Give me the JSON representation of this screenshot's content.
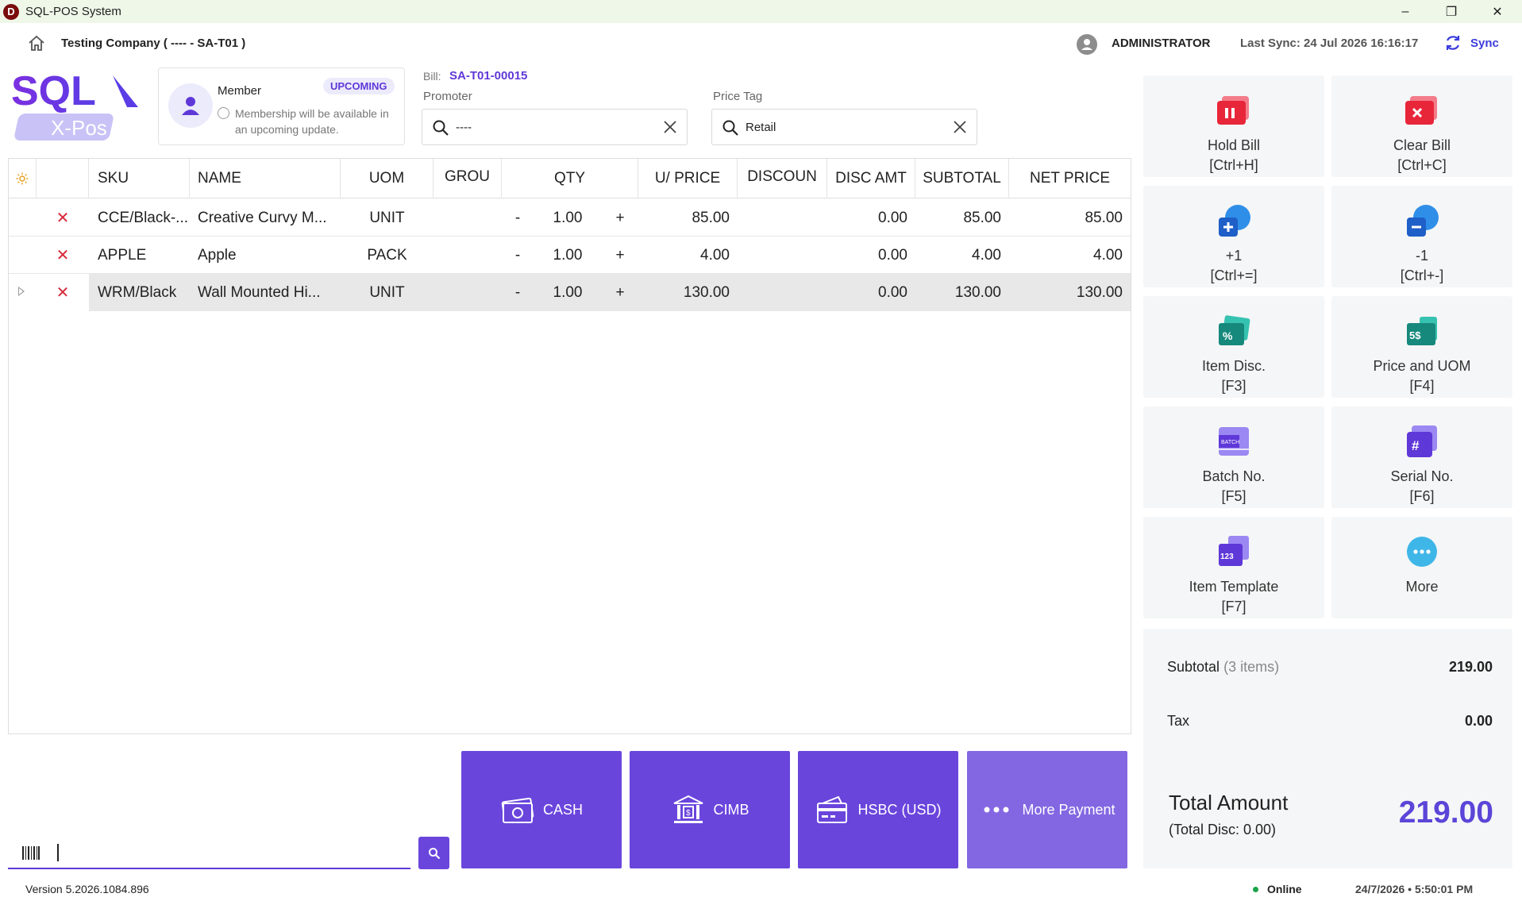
{
  "window": {
    "title": "SQL-POS System",
    "app_icon": "D",
    "minimize": "–",
    "restore": "❐",
    "close": "✕"
  },
  "header": {
    "company": "Testing Company ( ---- - SA-T01 )",
    "user": "ADMINISTRATOR",
    "last_sync": "Last Sync: 24 Jul 2026 16:16:17",
    "sync_label": "Sync"
  },
  "logo": {
    "top": "SQL",
    "bottom": "X-Pos"
  },
  "member": {
    "title": "Member",
    "badge": "UPCOMING",
    "note": "Membership will be available in an upcoming update."
  },
  "bill": {
    "label": "Bill:",
    "number": "SA-T01-00015"
  },
  "promoter": {
    "label": "Promoter",
    "value": "----"
  },
  "price_tag": {
    "label": "Price Tag",
    "value": "Retail"
  },
  "grid": {
    "columns": {
      "sku": "SKU",
      "name": "NAME",
      "uom": "UOM",
      "group": "GROU",
      "qty": "QTY",
      "unit_price": "U/ PRICE",
      "discount": "DISCOUN",
      "disc_amt": "DISC AMT",
      "subtotal": "SUBTOTAL",
      "net_price": "NET PRICE"
    },
    "rows": [
      {
        "remove": "✕",
        "sku": "CCE/Black-...",
        "name": "Creative Curvy M...",
        "uom": "UNIT",
        "minus": "-",
        "qty": "1.00",
        "plus": "+",
        "unit_price": "85.00",
        "disc_amt": "0.00",
        "subtotal": "85.00",
        "net_price": "85.00"
      },
      {
        "remove": "✕",
        "sku": "APPLE",
        "name": "Apple",
        "uom": "PACK",
        "minus": "-",
        "qty": "1.00",
        "plus": "+",
        "unit_price": "4.00",
        "disc_amt": "0.00",
        "subtotal": "4.00",
        "net_price": "4.00"
      },
      {
        "remove": "✕",
        "sku": "WRM/Black",
        "name": "Wall Mounted Hi...",
        "uom": "UNIT",
        "minus": "-",
        "qty": "1.00",
        "plus": "+",
        "unit_price": "130.00",
        "disc_amt": "0.00",
        "subtotal": "130.00",
        "net_price": "130.00"
      }
    ]
  },
  "functions": [
    {
      "label": "Hold Bill",
      "key": "[Ctrl+H]"
    },
    {
      "label": "Clear Bill",
      "key": "[Ctrl+C]"
    },
    {
      "label": "+1",
      "key": "[Ctrl+=]"
    },
    {
      "label": "-1",
      "key": "[Ctrl+-]"
    },
    {
      "label": "Item Disc.",
      "key": "[F3]"
    },
    {
      "label": "Price and UOM",
      "key": "[F4]"
    },
    {
      "label": "Batch No.",
      "key": "[F5]"
    },
    {
      "label": "Serial No.",
      "key": "[F6]"
    },
    {
      "label": "Item Template",
      "key": "[F7]"
    },
    {
      "label": "More",
      "key": ""
    }
  ],
  "summary": {
    "subtotal_label": "Subtotal",
    "subtotal_count": "(3 items)",
    "subtotal_value": "219.00",
    "tax_label": "Tax",
    "tax_value": "0.00",
    "total_label": "Total Amount",
    "total_disc": "(Total Disc: 0.00)",
    "total_value": "219.00"
  },
  "payments": [
    {
      "label": "CASH",
      "icon": "cash-icon"
    },
    {
      "label": "CIMB",
      "icon": "bank-icon"
    },
    {
      "label": "HSBC (USD)",
      "icon": "card-icon"
    },
    {
      "label": "More Payment",
      "icon": "more-dots-icon"
    }
  ],
  "footer": {
    "version": "Version 5.2026.1084.896",
    "status": "Online",
    "datetime": "24/7/2026 • 5:50:01 PM"
  },
  "colors": {
    "accent": "#6a45dc",
    "accent_light": "#8367e2",
    "remove": "#d62b3a",
    "online": "#1aa34a",
    "titlebar": "#eef7e8"
  }
}
